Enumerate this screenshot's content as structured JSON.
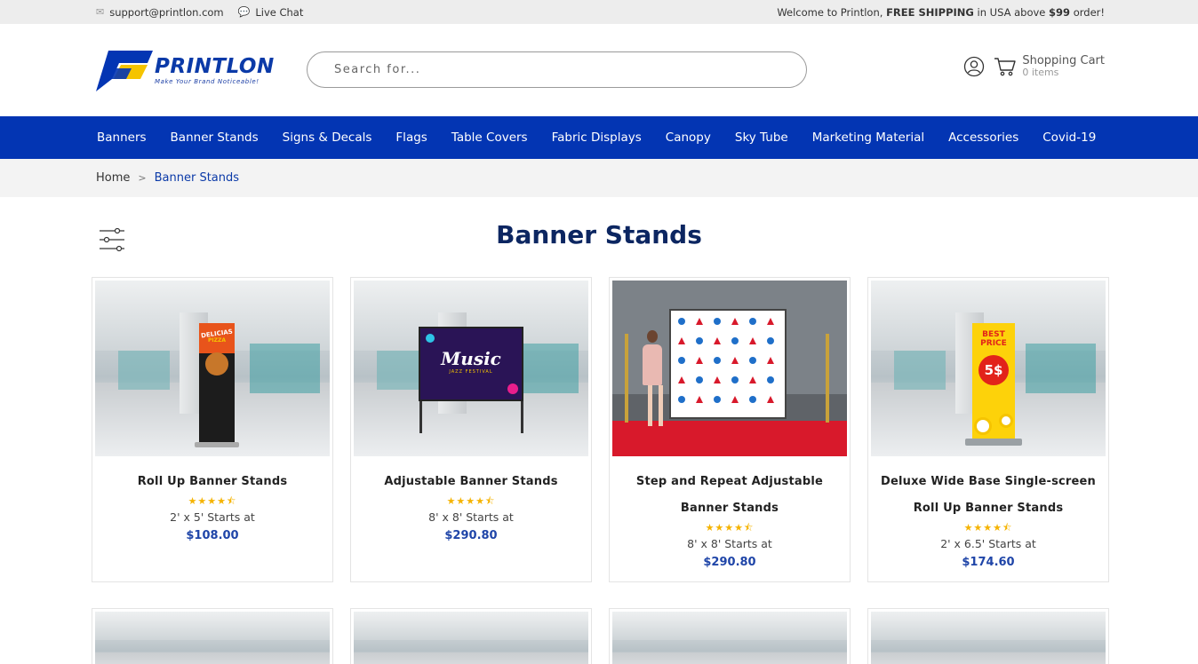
{
  "topbar": {
    "email": "support@printlon.com",
    "live_chat": "Live Chat",
    "welcome_prefix": "Welcome to Printlon, ",
    "free_shipping": "FREE SHIPPING",
    "welcome_mid": " in USA above ",
    "threshold": "$99",
    "welcome_suffix": " order!"
  },
  "header": {
    "logo_name": "PRINTLON",
    "logo_tagline": "Make Your Brand Noticeable!",
    "search_placeholder": "Search for...",
    "cart_title": "Shopping Cart",
    "cart_count": "0 items",
    "colors": {
      "brand_blue": "#0335b3",
      "brand_yellow": "#f5c400"
    }
  },
  "nav": {
    "items": [
      "Banners",
      "Banner Stands",
      "Signs & Decals",
      "Flags",
      "Table Covers",
      "Fabric Displays",
      "Canopy",
      "Sky Tube",
      "Marketing Material",
      "Accessories",
      "Covid-19"
    ]
  },
  "breadcrumb": {
    "home": "Home",
    "separator": ">",
    "current": "Banner Stands"
  },
  "page": {
    "title": "Banner Stands"
  },
  "products": [
    {
      "name_line1": "Roll Up Banner Stands",
      "name_line2": "",
      "rating": 4.5,
      "stars": "★★★★⯪",
      "size": "2' x 5' Starts at",
      "price": "$108.00",
      "banner_text": "DELICIAS",
      "banner_sub": "PIZZA"
    },
    {
      "name_line1": "Adjustable Banner Stands",
      "name_line2": "",
      "rating": 4.5,
      "stars": "★★★★⯪",
      "size": "8' x 8' Starts at",
      "price": "$290.80",
      "banner_text": "Music",
      "banner_sub": "JAZZ FESTIVAL"
    },
    {
      "name_line1": "Step and Repeat Adjustable",
      "name_line2": "Banner Stands",
      "rating": 4.5,
      "stars": "★★★★⯪",
      "size": "8' x 8' Starts at",
      "price": "$290.80",
      "banner_text": "",
      "banner_sub": ""
    },
    {
      "name_line1": "Deluxe Wide Base Single-screen",
      "name_line2": "Roll Up Banner Stands",
      "rating": 4.5,
      "stars": "★★★★⯪",
      "size": "2' x 6.5' Starts at",
      "price": "$174.60",
      "banner_text": "BEST PRICE",
      "banner_sub": "5$"
    }
  ]
}
